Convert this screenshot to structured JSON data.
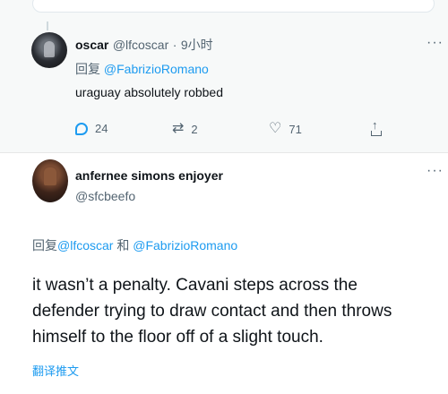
{
  "tweet1": {
    "author_name": "oscar",
    "author_handle": "@lfcoscar",
    "separator": "·",
    "time": "9小时",
    "reply_prefix": "回复",
    "reply_to": "@FabrizioRomano",
    "text": "uraguay absolutely robbed",
    "more": "···",
    "actions": {
      "reply_count": "24",
      "retweet_count": "2",
      "like_count": "71"
    }
  },
  "tweet2": {
    "author_name": "anfernee simons enjoyer",
    "author_handle": "@sfcbeefo",
    "more": "···",
    "reply_prefix": "回复",
    "reply_to_1": "@lfcoscar",
    "reply_and": "和",
    "reply_to_2": "@FabrizioRomano",
    "text": "it wasn’t a penalty. Cavani steps across the defender trying to draw contact and then throws himself to the floor off of a slight touch.",
    "translate": "翻译推文"
  },
  "icons": {
    "reply": "reply-icon",
    "retweet": "retweet-icon",
    "like": "heart-icon",
    "share": "share-icon",
    "more": "more-icon"
  },
  "colors": {
    "link": "#1d9bf0",
    "muted": "#536471",
    "text": "#0f1419",
    "reply_bg": "#f7f9f9"
  }
}
